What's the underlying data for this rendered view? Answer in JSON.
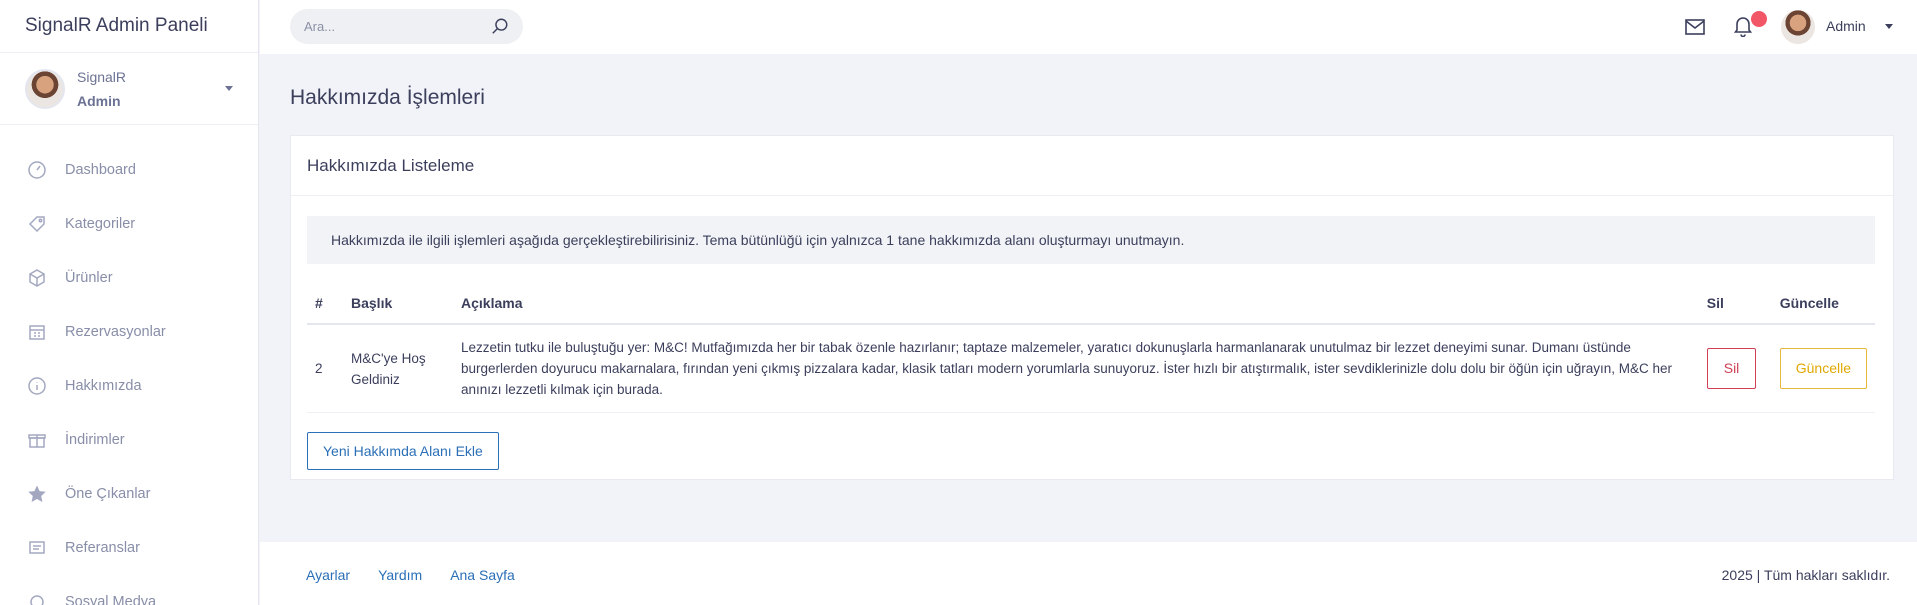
{
  "sidebar": {
    "brand": "SignalR Admin Paneli",
    "user": {
      "name": "SignalR",
      "role": "Admin"
    },
    "items": [
      {
        "label": "Dashboard",
        "icon": "gauge-icon"
      },
      {
        "label": "Kategoriler",
        "icon": "tag-icon"
      },
      {
        "label": "Ürünler",
        "icon": "box-icon"
      },
      {
        "label": "Rezervasyonlar",
        "icon": "calendar-icon"
      },
      {
        "label": "Hakkımızda",
        "icon": "info-icon"
      },
      {
        "label": "İndirimler",
        "icon": "gift-icon"
      },
      {
        "label": "Öne Çıkanlar",
        "icon": "star-icon"
      },
      {
        "label": "Referanslar",
        "icon": "message-icon"
      },
      {
        "label": "Sosyal Medya",
        "icon": "share-icon"
      }
    ]
  },
  "topbar": {
    "search_placeholder": "Ara...",
    "user_name": "Admin"
  },
  "page": {
    "title": "Hakkımızda İşlemleri",
    "card_title": "Hakkımızda Listeleme",
    "info_text": "Hakkımızda ile ilgili işlemleri aşağıda gerçekleştirebilirisiniz. Tema bütünlüğü için yalnızca 1 tane hakkımızda alanı oluşturmayı unutmayın.",
    "table": {
      "headers": {
        "num": "#",
        "title": "Başlık",
        "desc": "Açıklama",
        "delete": "Sil",
        "update": "Güncelle"
      },
      "rows": [
        {
          "id": "2",
          "title": "M&C'ye Hoş Geldiniz",
          "description": "Lezzetin tutku ile buluştuğu yer: M&C! Mutfağımızda her bir tabak özenle hazırlanır; taptaze malzemeler, yaratıcı dokunuşlarla harmanlanarak unutulmaz bir lezzet deneyimi sunar. Dumanı üstünde burgerlerden doyurucu makarnalara, fırından yeni çıkmış pizzalara kadar, klasik tatları modern yorumlarla sunuyoruz. İster hızlı bir atıştırmalık, ister sevdiklerinizle dolu dolu bir öğün için uğrayın, M&C her anınızı lezzetli kılmak için burada.",
          "delete_label": "Sil",
          "update_label": "Güncelle"
        }
      ]
    },
    "add_button": "Yeni Hakkımda Alanı Ekle"
  },
  "footer": {
    "links": [
      "Ayarlar",
      "Yardım",
      "Ana Sayfa"
    ],
    "copyright": "2025 | Tüm hakları saklıdır."
  },
  "colors": {
    "primary": "#2b6fb6",
    "danger": "#d03f55",
    "warning": "#e0a800",
    "notification_badge": "#f25767"
  }
}
